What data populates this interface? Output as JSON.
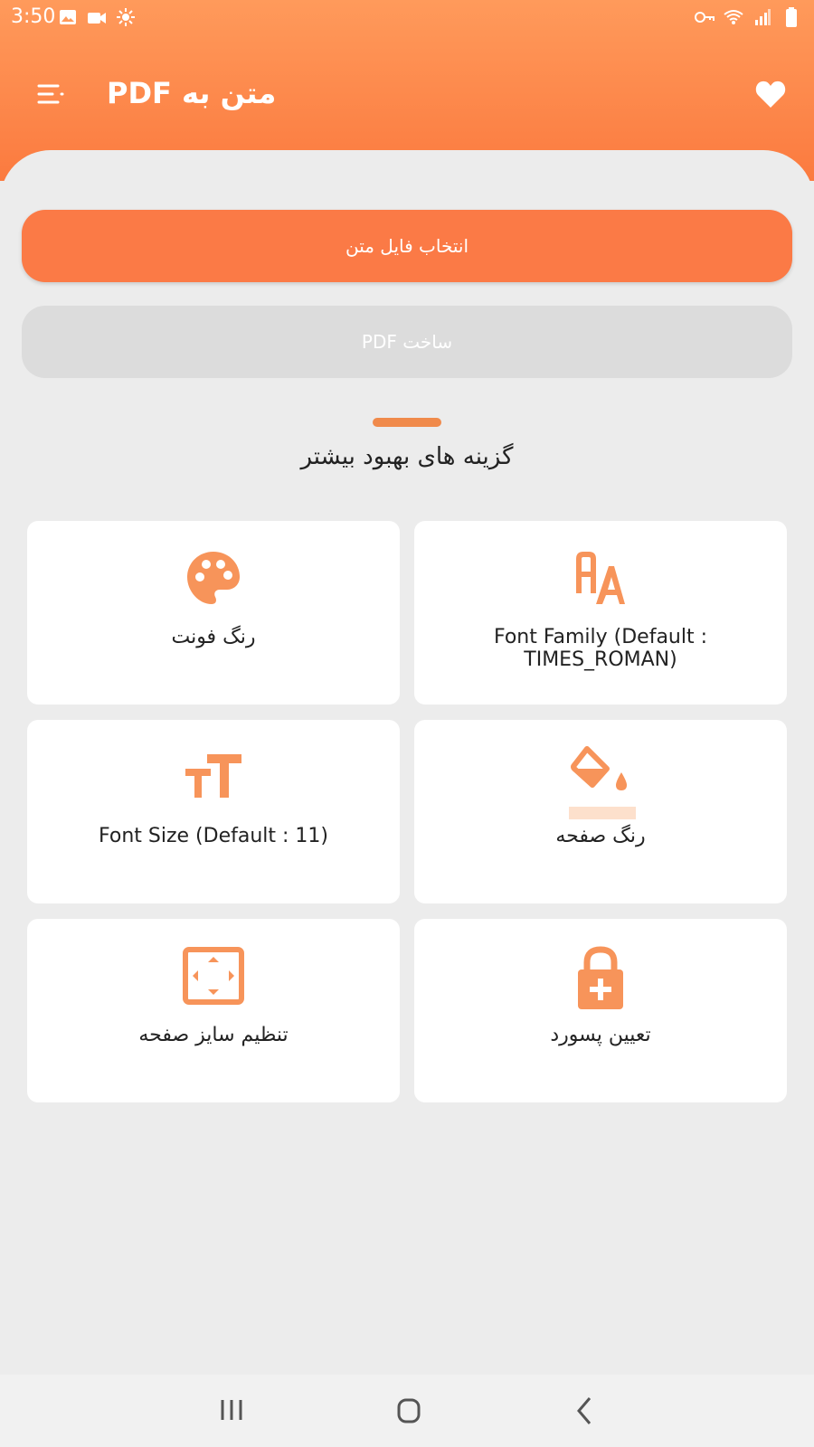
{
  "status_bar": {
    "time": "3:50",
    "icons_left": [
      "gallery-icon",
      "video-camera-icon",
      "settings-sun-icon"
    ],
    "icons_right": [
      "vpn-key-icon",
      "wifi-icon",
      "signal-icon",
      "battery-icon"
    ]
  },
  "app_bar": {
    "title": "متن به PDF",
    "menu_icon": "menu-icon",
    "favorite_icon": "heart-icon"
  },
  "buttons": {
    "select_file": "انتخاب فایل متن",
    "create_pdf": "ساخت PDF"
  },
  "section": {
    "title": "گزینه های بهبود بیشتر"
  },
  "options": [
    {
      "label": "رنگ فونت",
      "icon": "palette-icon"
    },
    {
      "label": "Font Family (Default : TIMES_ROMAN)",
      "icon": "font-family-icon"
    },
    {
      "label": "Font Size (Default : 11)",
      "icon": "font-size-icon"
    },
    {
      "label": "رنگ صفحه",
      "icon": "paint-bucket-icon"
    },
    {
      "label": "تنظیم سایز صفحه",
      "icon": "page-size-icon"
    },
    {
      "label": "تعیین پسورد",
      "icon": "lock-add-icon"
    }
  ],
  "colors": {
    "accent": "#fb7a46",
    "icon": "#f7945a",
    "disabled": "#dcdcdc"
  },
  "nav_bar": {
    "recent": "recent-apps-icon",
    "home": "home-icon",
    "back": "back-icon"
  }
}
